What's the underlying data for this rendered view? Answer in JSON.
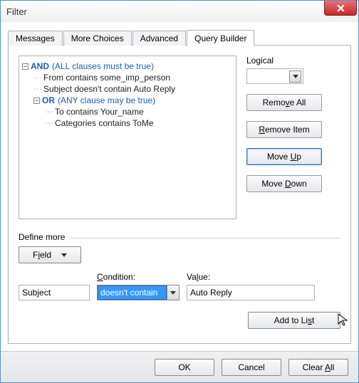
{
  "window": {
    "title": "Filter"
  },
  "tabs": [
    {
      "label": "Messages"
    },
    {
      "label": "More Choices"
    },
    {
      "label": "Advanced"
    },
    {
      "label": "Query Builder",
      "active": true
    }
  ],
  "tree": {
    "and": {
      "keyword": "AND",
      "desc": "(ALL clauses must be true)"
    },
    "and_children": [
      "From contains some_imp_person",
      "Subject doesn't contain Auto Reply"
    ],
    "or": {
      "keyword": "OR",
      "desc": "(ANY clause may be true)"
    },
    "or_children": [
      "To contains Your_name",
      "Categories contains ToMe"
    ]
  },
  "side": {
    "logical_label": "Logical",
    "remove_all_pre": "Remo",
    "remove_all_u": "v",
    "remove_all_post": "e All",
    "remove_item_u": "R",
    "remove_item_post": "emove Item",
    "move_up_pre": "Move ",
    "move_up_u": "U",
    "move_up_post": "p",
    "move_down_pre": "Move ",
    "move_down_u": "D",
    "move_down_post": "own"
  },
  "define": {
    "header": "Define more",
    "field_pre": "F",
    "field_u": "i",
    "field_post": "eld",
    "condition_pre": "",
    "condition_u": "C",
    "condition_post": "ondition:",
    "value_pre": "Va",
    "value_u": "l",
    "value_post": "ue:",
    "field_name": "Subject",
    "condition_val": "doesn't contain",
    "value_val": "Auto Reply",
    "add_pre": "Add to Li",
    "add_u": "s",
    "add_post": "t"
  },
  "footer": {
    "ok": "OK",
    "cancel": "Cancel",
    "clear_pre": "Clear ",
    "clear_u": "A",
    "clear_post": "ll"
  }
}
